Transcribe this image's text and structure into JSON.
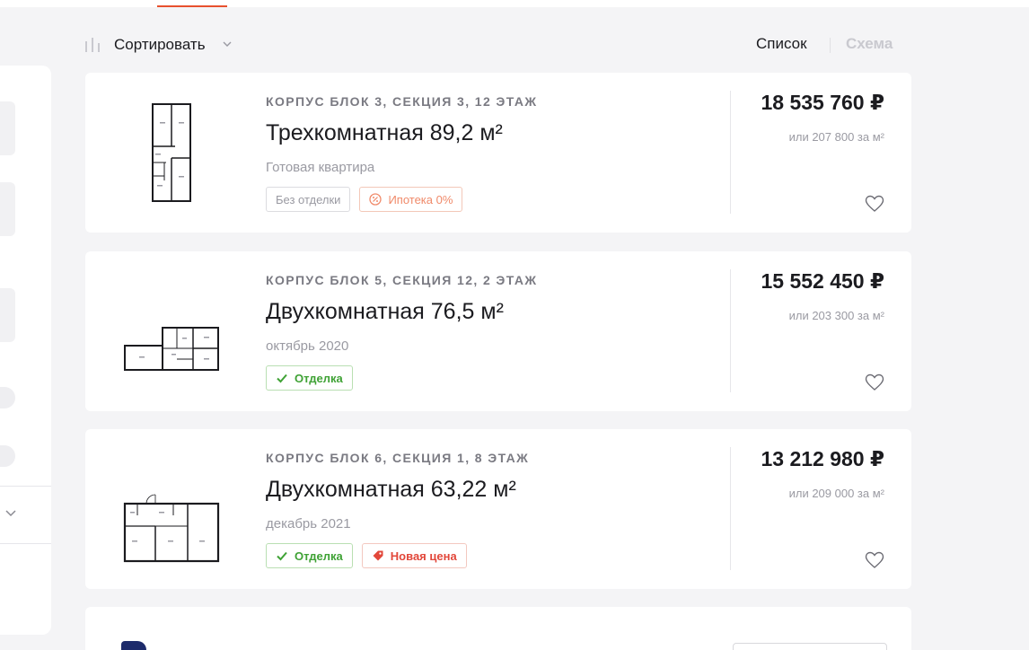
{
  "toolbar": {
    "sort_label": "Сортировать",
    "view_list_label": "Список",
    "view_scheme_label": "Схема",
    "icons": {
      "sort": "bars-icon",
      "sort_dropdown": "chevron-down-icon"
    }
  },
  "colors": {
    "accent": "#e8512e",
    "finish_green": "#3fa235",
    "new_price_red": "#e2473a",
    "mortgage_orange": "#f08a6a",
    "muted": "#9a9aa2"
  },
  "listings": [
    {
      "location": "КОРПУС БЛОК 3, СЕКЦИЯ 3, 12 ЭТАЖ",
      "title": "Трехкомнатная 89,2 м²",
      "subtitle": "Готовая квартира",
      "badges": [
        {
          "label": "Без отделки",
          "kind": "plain"
        },
        {
          "label": "Ипотека 0%",
          "kind": "mortgage",
          "icon": "percent-icon"
        }
      ],
      "price": "18 535 760 ₽",
      "price_per_m": "или 207 800 за м²",
      "favorite_icon": "heart-icon"
    },
    {
      "location": "КОРПУС БЛОК 5, СЕКЦИЯ 12, 2 ЭТАЖ",
      "title": "Двухкомнатная 76,5 м²",
      "subtitle": "октябрь 2020",
      "badges": [
        {
          "label": "Отделка",
          "kind": "finish",
          "icon": "check-icon"
        }
      ],
      "price": "15 552 450 ₽",
      "price_per_m": "или 203 300 за м²",
      "favorite_icon": "heart-icon"
    },
    {
      "location": "КОРПУС БЛОК 6, СЕКЦИЯ 1, 8 ЭТАЖ",
      "title": "Двухкомнатная 63,22 м²",
      "subtitle": "декабрь 2021",
      "badges": [
        {
          "label": "Отделка",
          "kind": "finish",
          "icon": "check-icon"
        },
        {
          "label": "Новая цена",
          "kind": "newprice",
          "icon": "tag-icon"
        }
      ],
      "price": "13 212 980 ₽",
      "price_per_m": "или 209 000 за м²",
      "favorite_icon": "heart-icon"
    }
  ]
}
